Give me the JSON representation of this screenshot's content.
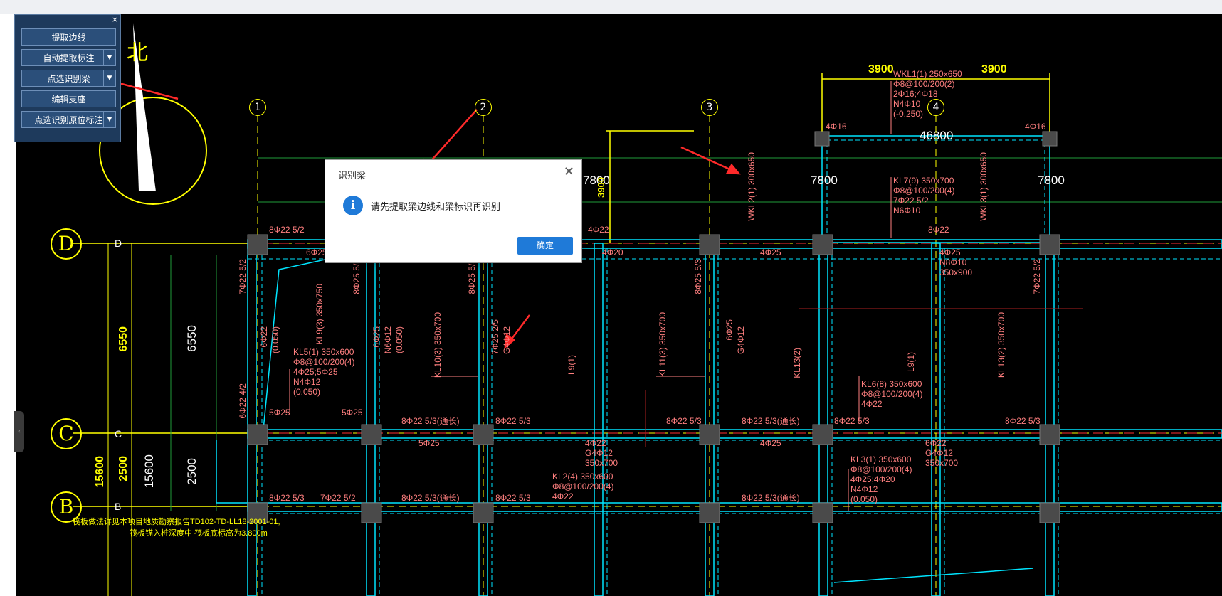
{
  "toolbox": {
    "close_glyph": "×",
    "buttons": [
      {
        "label": "提取边线"
      },
      {
        "label": "自动提取标注"
      },
      {
        "label": "点选识别梁"
      },
      {
        "label": "编辑支座"
      },
      {
        "label": "点选识别原位标注"
      }
    ]
  },
  "dialog": {
    "title": "识别梁",
    "message": "请先提取梁边线和梁标识再识别",
    "ok_label": "确定",
    "close_glyph": "✕",
    "icon_glyph": "i"
  },
  "drawing": {
    "north_label": "北",
    "axis_rows": [
      "D",
      "C",
      "B"
    ],
    "axis_cols": [
      "1",
      "2",
      "3",
      "4"
    ],
    "dims_top": [
      "3900",
      "3900"
    ],
    "dim_total": "46800",
    "dims_7800": [
      "7800",
      "7800",
      "7800"
    ],
    "dim_3900_vert": "3900",
    "dims_left_yellow": [
      "6550",
      "2500",
      "15600"
    ],
    "dims_left_white": [
      "6550",
      "15600",
      "2500"
    ],
    "beam_labels": {
      "wkl1": "WKL1(1) 250x650",
      "wkl1_2": "Φ8@100/200(2)",
      "wkl1_3": "2Φ16;4Φ18",
      "wkl1_4": "N4Φ10",
      "wkl1_5": "(-0.250)",
      "wkl2": "WKL2(1) 300x650",
      "kl7": "KL7(9) 350x700",
      "kl7_2": "Φ8@100/200(4)",
      "kl7_3": "7Φ22 5/2",
      "kl7_4": "N6Φ10",
      "wkl3": "WKL3(1) 300x650",
      "kl5": "KL5(1) 350x600",
      "kl5_2": "Φ8@100/200(4)",
      "kl5_3": "4Φ25;5Φ25",
      "kl5_4": "N4Φ12",
      "kl5_5": "(0.050)",
      "kl9": "KL9(3) 350x750",
      "kl10": "KL10(3) 350x700",
      "kl11": "KL11(3) 350x700",
      "kl13": "KL13(2)",
      "kl13b": "KL13(2) 350x700",
      "l9": "L9(1)",
      "l9b": "L9(1)",
      "kl6": "KL6(8) 350x600",
      "kl6_2": "Φ8@100/200(4)",
      "kl6_3": "4Φ22",
      "kl3": "KL3(1) 350x600",
      "kl3_2": "Φ8@100/200(4)",
      "kl3_3": "4Φ25;4Φ20",
      "kl3_4": "N4Φ12",
      "kl3_5": "(0.050)",
      "kl2": "KL2(4) 350x600",
      "kl2_2": "Φ8@100/200(4)",
      "kl2_3": "4Φ22",
      "t_8d22_52": "8Φ22 5/2",
      "t_6d25": "6Φ25",
      "t_4d25": "4Φ25",
      "t_4d22": "4Φ22",
      "t_4d20": "4Φ20",
      "t_4d16a": "4Φ16",
      "t_4d16b": "4Φ16",
      "t_n8d10": "N8Φ10",
      "t_350x900": "350x900",
      "t_8d22_53_a": "8Φ22 5/3(通长)",
      "t_8d22_53_b": "8Φ22 5/3",
      "t_8d22_53_c": "8Φ22 5/3",
      "t_8d22_53_d": "8Φ22 5/3(通长)",
      "t_8d22_53_e": "8Φ22 5/3",
      "t_5d25_a": "5Φ25",
      "t_5d25_b": "5Φ25",
      "t_5d25_c": "5Φ25",
      "t_4d25_b": "4Φ25",
      "t_g4d12": "G4Φ12",
      "t_350x700": "350x700",
      "t_6d22_b": "6Φ22",
      "t_g4d12_b": "G4Φ12",
      "t_350x700_b": "350x700",
      "t_8d22_53_f": "8Φ22 5/3",
      "t_7d22_52": "7Φ22 5/2",
      "t_8d22_53_g": "8Φ22 5/3(通长)",
      "t_8d22_53_h": "8Φ22 5/3",
      "t_8d22_53_i": "8Φ22 5/3",
      "t_8d22_53_j": "8Φ22 5/3(通长)",
      "t_8d22": "8Φ22",
      "t_vleft1": "7Φ22 5/2",
      "t_vleft2": "6Φ22 4/2",
      "t_v1": "8Φ25 5/3",
      "t_v2": "8Φ25 5/3",
      "t_v3": "8Φ25 5/3",
      "t_v4": "7Φ22 5/2",
      "t_v5": "6Φ22",
      "t_v6": "7Φ25 2/5",
      "t_v7": "G4Φ12",
      "t_v8": "6Φ25",
      "t_v9": "G4Φ12",
      "t_v10": "(0.050)",
      "t_v11": "6Φ25",
      "t_v12": "N6Φ12",
      "t_v13": "(0.050)"
    },
    "notes": [
      "筏板做法详见本项目地质勘察报告TD102-TD-LL18-2001-01,",
      "筏板锚入桩深度中  筏板底标高为3.800m"
    ]
  },
  "colors": {
    "canvas_bg": "#000000",
    "axis_yellow": "#ffff00",
    "beam_cyan": "#00e5ff",
    "rebar_text": "#ff7f7f",
    "annot_arrow": "#ff2a2a",
    "column_fill": "#4a4a4a",
    "toolbox_bg": "#1e3a5c",
    "dialog_accent": "#1f7ad8"
  }
}
